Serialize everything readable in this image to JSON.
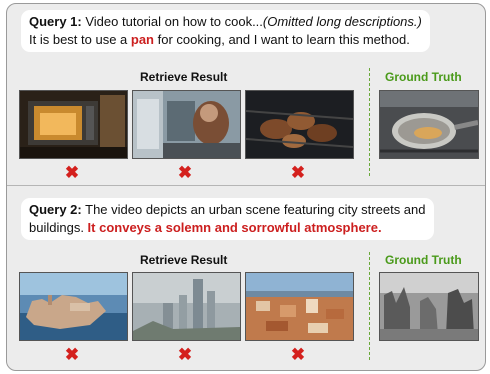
{
  "queries": [
    {
      "label": "Query 1:",
      "line1_text": " Video tutorial on how to cook...",
      "line1_italic": "(Omitted long descriptions.)",
      "line2_prefix": "It is best to use a ",
      "line2_highlight": "pan",
      "line2_suffix": " for cooking, and I want to learn this method.",
      "retrieve_label": "Retrieve Result",
      "ground_truth_label": "Ground Truth",
      "results": [
        {
          "icon": "microwave-oven-image",
          "correct": false
        },
        {
          "icon": "kitchen-person-image",
          "correct": false
        },
        {
          "icon": "grilled-meat-image",
          "correct": false
        }
      ],
      "ground_truth": {
        "icon": "pan-on-stove-image"
      },
      "mark": "✖"
    },
    {
      "label": "Query 2:",
      "line1_text": " The video depicts an urban scene featuring city streets and",
      "line2_prefix": "buildings. ",
      "line2_highlight": "It conveys a solemn and sorrowful atmosphere.",
      "retrieve_label": "Retrieve Result",
      "ground_truth_label": "Ground Truth",
      "results": [
        {
          "icon": "coastal-town-image",
          "correct": false
        },
        {
          "icon": "city-skyline-fog-image",
          "correct": false
        },
        {
          "icon": "european-rooftops-image",
          "correct": false
        }
      ],
      "ground_truth": {
        "icon": "ruined-city-bw-image"
      },
      "mark": "✖"
    }
  ],
  "colors": {
    "highlight": "#cc1f1f",
    "ground_truth": "#4a9a1a",
    "cross": "#d4201d"
  }
}
